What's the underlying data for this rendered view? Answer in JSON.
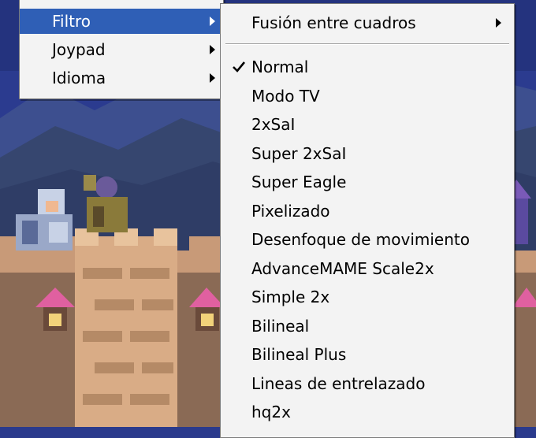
{
  "main_menu": {
    "items": [
      {
        "label": "Filtro",
        "has_submenu": true,
        "selected": true
      },
      {
        "label": "Joypad",
        "has_submenu": true,
        "selected": false
      },
      {
        "label": "Idioma",
        "has_submenu": true,
        "selected": false
      }
    ]
  },
  "filter_menu": {
    "header_item": {
      "label": "Fusión entre cuadros",
      "has_submenu": true
    },
    "items": [
      {
        "label": "Normal",
        "checked": true
      },
      {
        "label": "Modo TV",
        "checked": false
      },
      {
        "label": "2xSaI",
        "checked": false
      },
      {
        "label": "Super 2xSaI",
        "checked": false
      },
      {
        "label": "Super Eagle",
        "checked": false
      },
      {
        "label": "Pixelizado",
        "checked": false
      },
      {
        "label": "Desenfoque de movimiento",
        "checked": false
      },
      {
        "label": "AdvanceMAME Scale2x",
        "checked": false
      },
      {
        "label": "Simple 2x",
        "checked": false
      },
      {
        "label": "Bilineal",
        "checked": false
      },
      {
        "label": "Bilineal Plus",
        "checked": false
      },
      {
        "label": "Lineas de entrelazado",
        "checked": false
      },
      {
        "label": "hq2x",
        "checked": false
      }
    ]
  },
  "colors": {
    "menu_bg": "#f3f3f3",
    "highlight": "#2f5fb6",
    "sky": "#2a3a8c",
    "stone": "#d9a877"
  },
  "icons": {
    "checkmark": "check-icon",
    "submenu": "submenu-arrow-icon"
  }
}
